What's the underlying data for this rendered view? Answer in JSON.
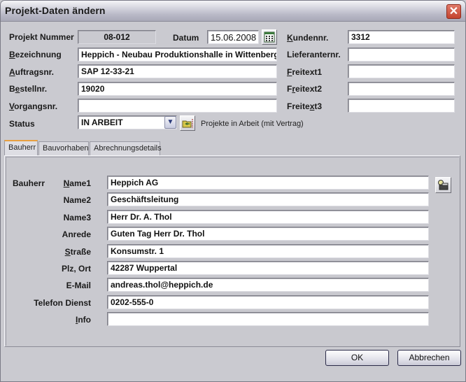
{
  "window": {
    "title": "Projekt-Daten ändern",
    "close_icon": "close-icon"
  },
  "header": {
    "projekt_nummer": {
      "label": "Projekt Nummer",
      "value": "08-012"
    },
    "datum": {
      "label": "Datum",
      "value": "15.06.2008",
      "icon": "calendar-icon"
    },
    "kundennr": {
      "label_u": "K",
      "label_rest": "undennr.",
      "value": "3312"
    },
    "bezeichnung": {
      "label_u": "B",
      "label_rest": "ezeichnung",
      "value": "Heppich - Neubau Produktionshalle in Wittenberg"
    },
    "lieferantennr": {
      "label": "Lieferanternr.",
      "value": ""
    },
    "auftragsnr": {
      "label_u": "A",
      "label_rest": "uftragsnr.",
      "value": "SAP 12-33-21"
    },
    "freitext1": {
      "label_u": "F",
      "label_rest": "reitext1",
      "value": ""
    },
    "bestellnr": {
      "label_a": "B",
      "label_u": "e",
      "label_rest": "stellnr.",
      "value": "19020"
    },
    "freitext2": {
      "label_a": "F",
      "label_u": "r",
      "label_rest": "eitext2",
      "value": ""
    },
    "vorgangsnr": {
      "label_u": "V",
      "label_rest": "organgsnr.",
      "value": ""
    },
    "freitext3": {
      "label_a": "Freite",
      "label_u": "x",
      "label_rest": "t3",
      "value": ""
    },
    "status": {
      "label": "Status",
      "value": "IN ARBEIT",
      "description": "Projekte in Arbeit (mit Vertrag)",
      "icon": "folder-edit-icon"
    }
  },
  "tabs": [
    {
      "label": "Bauherr",
      "active": true
    },
    {
      "label": "Bauvorhaben",
      "active": false
    },
    {
      "label": "Abrechnungsdetails",
      "active": false
    }
  ],
  "bauherr": {
    "section_label": "Bauherr",
    "lookup_icon": "address-book-icon",
    "fields": [
      {
        "label_u": "N",
        "label_rest": "ame1",
        "value": "Heppich AG"
      },
      {
        "label_u": "",
        "label_rest": "Name2",
        "value": "Geschäftsleitung"
      },
      {
        "label_u": "",
        "label_rest": "Name3",
        "value": "Herr Dr. A. Thol"
      },
      {
        "label_u": "",
        "label_rest": "Anrede",
        "value": "Guten Tag Herr Dr. Thol"
      },
      {
        "label_u": "S",
        "label_rest": "traße",
        "value": "Konsumstr. 1"
      },
      {
        "label_u": "",
        "label_rest": "Plz, Ort",
        "value": "42287 Wuppertal"
      },
      {
        "label_u": "",
        "label_rest": "E-Mail",
        "value": "andreas.thol@heppich.de"
      },
      {
        "label_u": "",
        "label_rest": "Telefon Dienst",
        "value": "0202-555-0"
      },
      {
        "label_u": "I",
        "label_rest": "nfo",
        "value": ""
      }
    ]
  },
  "buttons": {
    "ok": "OK",
    "cancel": "Abbrechen"
  }
}
